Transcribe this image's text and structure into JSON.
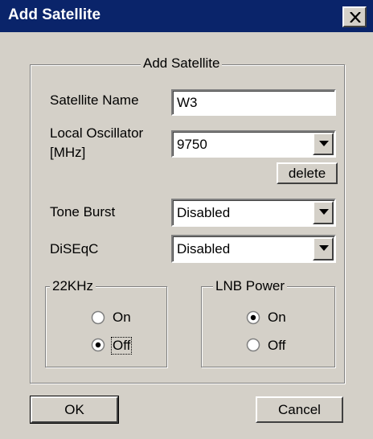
{
  "window": {
    "title": "Add Satellite"
  },
  "group_main": {
    "legend": "Add Satellite"
  },
  "satellite_name": {
    "label": "Satellite Name",
    "value": "W3"
  },
  "local_oscillator": {
    "label_line1": "Local Oscillator",
    "label_line2": "[MHz]",
    "value": "9750"
  },
  "delete_button": {
    "label": "delete"
  },
  "tone_burst": {
    "label": "Tone Burst",
    "value": "Disabled"
  },
  "diseqc": {
    "label": "DiSEqC",
    "value": "Disabled"
  },
  "khz22": {
    "legend": "22KHz",
    "on_label": "On",
    "off_label": "Off",
    "selected": "Off"
  },
  "lnb_power": {
    "legend": "LNB Power",
    "on_label": "On",
    "off_label": "Off",
    "selected": "On"
  },
  "ok_button": {
    "label": "OK"
  },
  "cancel_button": {
    "label": "Cancel"
  },
  "colors": {
    "title_bar": "#0a246a",
    "dialog_face": "#d4d0c8"
  },
  "icons": {
    "close": "close-icon",
    "dropdown": "chevron-down-icon"
  }
}
